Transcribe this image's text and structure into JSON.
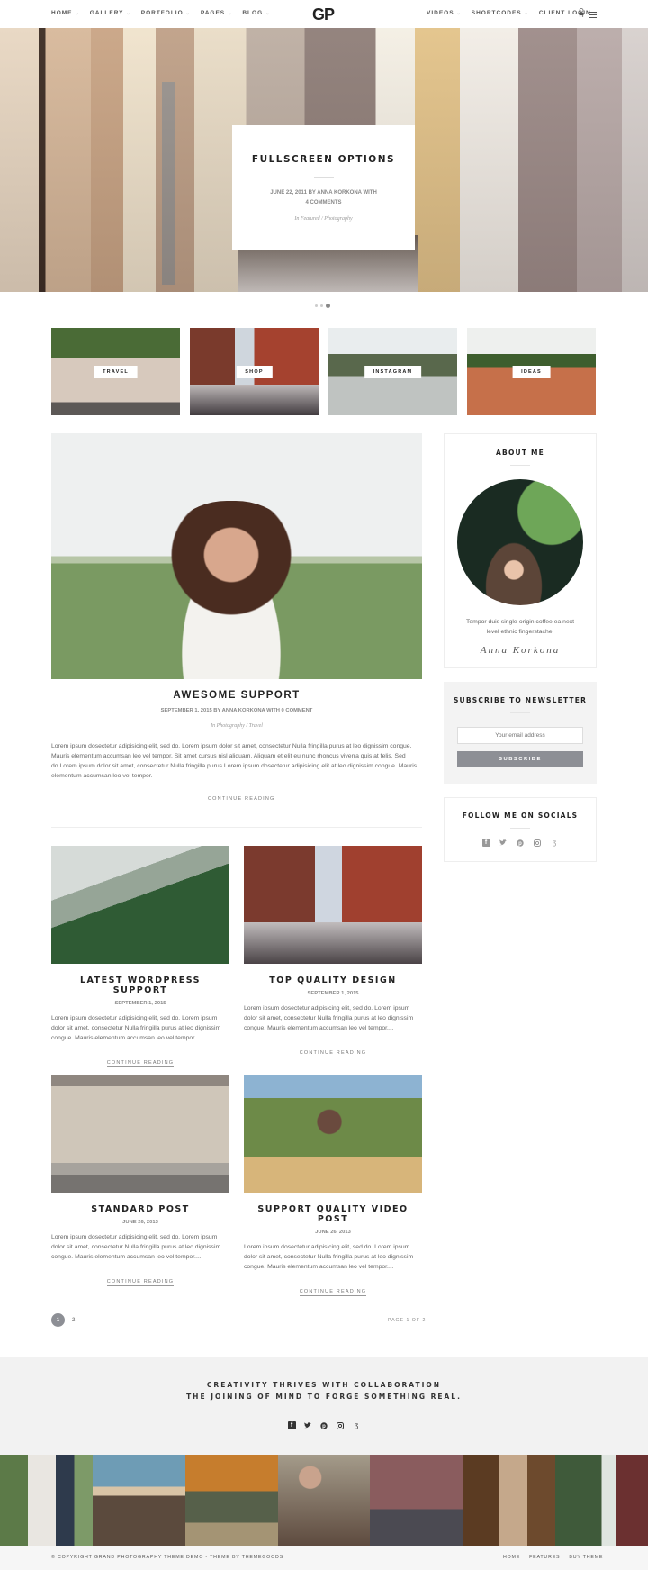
{
  "header": {
    "logo": "GP",
    "nav_left": [
      {
        "label": "HOME"
      },
      {
        "label": "GALLERY"
      },
      {
        "label": "PORTFOLIO"
      },
      {
        "label": "PAGES"
      },
      {
        "label": "BLOG"
      }
    ],
    "nav_right": [
      {
        "label": "VIDEOS"
      },
      {
        "label": "SHORTCODES"
      },
      {
        "label": "CLIENT LOGIN"
      }
    ],
    "chevron": "⌄",
    "icons": [
      "cart-icon",
      "menu-icon"
    ]
  },
  "hero": {
    "title": "FULLSCREEN OPTIONS",
    "meta_line1": "JUNE 22, 2011 BY  ANNA KORKONA WITH",
    "meta_line2": "4 COMMENTS",
    "categories": "In  Featured  /  Photography",
    "slides_total": 3,
    "active_slide": 3
  },
  "category_tiles": [
    {
      "label": "TRAVEL"
    },
    {
      "label": "SHOP"
    },
    {
      "label": "INSTAGRAM"
    },
    {
      "label": "IDEAS"
    }
  ],
  "featured_post": {
    "title": "AWESOME SUPPORT",
    "meta": "SEPTEMBER 1, 2015 BY  ANNA KORKONA WITH  0 COMMENT",
    "categories": "In  Photography  /  Travel",
    "excerpt": "Lorem ipsum dosectetur adipisicing elit, sed do. Lorem ipsum dolor sit amet, consectetur Nulla fringilla purus at leo dignissim congue. Mauris elementum accumsan leo vel tempor. Sit amet cursus nisl aliquam. Aliquam et elit eu nunc rhoncus viverra quis at felis. Sed do.Lorem ipsum dolor sit amet, consectetur Nulla fringilla purus Lorem ipsum dosectetur adipisicing elit at leo dignissim congue. Mauris elementum accumsan leo vel tempor.",
    "continue_label": "CONTINUE READING"
  },
  "grid_posts": [
    {
      "title": "LATEST WORDPRESS SUPPORT",
      "date": "SEPTEMBER 1, 2015",
      "excerpt": "Lorem ipsum dosectetur adipisicing elit, sed do. Lorem ipsum dolor sit amet, consectetur Nulla fringilla purus at leo dignissim congue. Mauris elementum accumsan leo vel tempor....",
      "continue_label": "CONTINUE READING"
    },
    {
      "title": "TOP QUALITY DESIGN",
      "date": "SEPTEMBER 1, 2015",
      "excerpt": "Lorem ipsum dosectetur adipisicing elit, sed do. Lorem ipsum dolor sit amet, consectetur Nulla fringilla purus at leo dignissim congue. Mauris elementum accumsan leo vel tempor....",
      "continue_label": "CONTINUE READING"
    },
    {
      "title": "STANDARD POST",
      "date": "JUNE 26, 2013",
      "excerpt": "Lorem ipsum dosectetur adipisicing elit, sed do. Lorem ipsum dolor sit amet, consectetur Nulla fringilla purus at leo dignissim congue. Mauris elementum accumsan leo vel tempor....",
      "continue_label": "CONTINUE READING"
    },
    {
      "title": "SUPPORT QUALITY VIDEO POST",
      "date": "JUNE 26, 2013",
      "excerpt": "Lorem ipsum dosectetur adipisicing elit, sed do. Lorem ipsum dolor sit amet, consectetur Nulla fringilla purus at leo dignissim congue. Mauris elementum accumsan leo vel tempor....",
      "continue_label": "CONTINUE READING"
    }
  ],
  "pagination": {
    "pages": [
      "1",
      "2"
    ],
    "current": "1",
    "summary": "PAGE 1 OF 2"
  },
  "sidebar": {
    "about": {
      "title": "ABOUT ME",
      "bio": "Tempor duis single-origin coffee ea next level ethnic fingerstache.",
      "signature": "Anna Korkona"
    },
    "newsletter": {
      "title": "SUBSCRIBE TO NEWSLETTER",
      "email_placeholder": "Your email address",
      "email_value": "",
      "button_label": "SUBSCRIBE"
    },
    "socials": {
      "title": "FOLLOW ME ON SOCIALS",
      "icons": [
        {
          "name": "facebook-icon",
          "glyph": "f"
        },
        {
          "name": "twitter-icon",
          "glyph": "🐦︎"
        },
        {
          "name": "pinterest-icon",
          "glyph": "℗"
        },
        {
          "name": "instagram-icon",
          "glyph": "◎"
        },
        {
          "name": "500px-icon",
          "glyph": "ʒ"
        }
      ]
    }
  },
  "footer_band": {
    "line1": "CREATIVITY THRIVES WITH COLLABORATION",
    "line2": "THE JOINING OF MIND TO FORGE SOMETHING REAL.",
    "icons": [
      {
        "name": "facebook-icon",
        "glyph": "f"
      },
      {
        "name": "twitter-icon",
        "glyph": "🐦︎"
      },
      {
        "name": "pinterest-icon",
        "glyph": "℗"
      },
      {
        "name": "instagram-icon",
        "glyph": "◎"
      },
      {
        "name": "500px-icon",
        "glyph": "ʒ"
      }
    ]
  },
  "instagram_strip": {
    "photos": [
      "couple-kissing",
      "concert-crowd",
      "forest-wedding-aisle",
      "smiling-old-man",
      "canyon-hiker",
      "library-reader",
      "upside-down-woman"
    ]
  },
  "footer": {
    "copyright": "© COPYRIGHT GRAND PHOTOGRAPHY THEME DEMO - THEME BY THEMEGOODS",
    "links": [
      "HOME",
      "FEATURES",
      "BUY THEME"
    ]
  }
}
